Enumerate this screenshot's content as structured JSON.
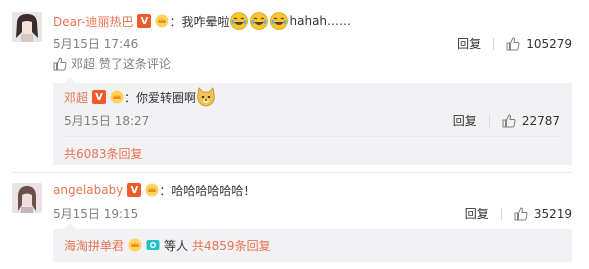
{
  "comments": [
    {
      "username": "Dear-迪丽热巴",
      "text_before_emoji": "：我咋晕啦",
      "text_after_emoji": "hahah……",
      "time": "5月15日 17:46",
      "reply_label": "回复",
      "like_count": "105279",
      "liked_by": "邓超 赞了这条评论",
      "replies": [
        {
          "username": "邓超",
          "text": "：你爱转圈啊",
          "time": "5月15日 18:27",
          "reply_label": "回复",
          "like_count": "22787"
        }
      ],
      "more_replies": "共6083条回复"
    },
    {
      "username": "angelababy",
      "text": "：哈哈哈哈哈哈！",
      "time": "5月15日 19:15",
      "reply_label": "回复",
      "like_count": "35219",
      "reply_summary": {
        "names": "海淘拼单君",
        "others": "等人",
        "count": "共4859条回复"
      }
    }
  ],
  "colors": {
    "username": "#eb7350",
    "reply_bg": "#f2f2f5",
    "vip_badge": "#ea5d2a",
    "emoji_yellow": "#f7c531"
  },
  "icons": [
    "thumbs-up-icon",
    "verified-v-icon",
    "vip-crown-icon",
    "laughing-cry-emoji",
    "doge-emoji",
    "camera-badge-icon"
  ]
}
